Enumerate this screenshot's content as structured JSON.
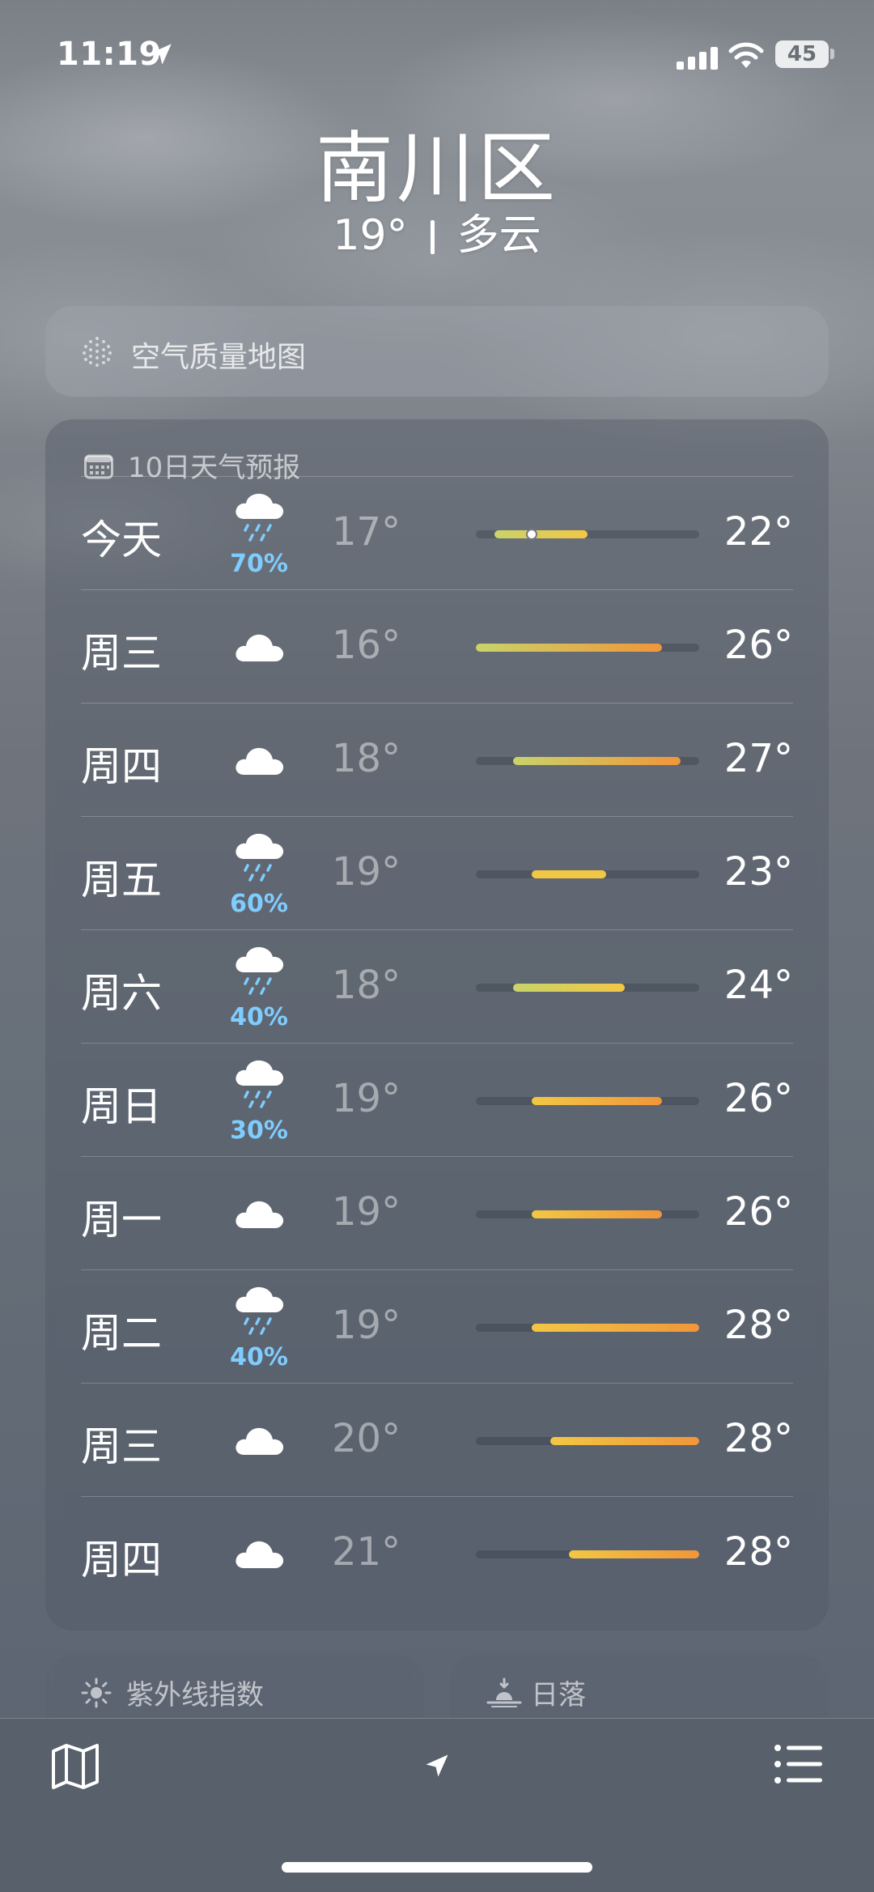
{
  "status_bar": {
    "time": "11:19",
    "battery": "45",
    "icons": [
      "location-arrow-icon",
      "cellular-signal-icon",
      "wifi-icon",
      "battery-icon"
    ]
  },
  "header": {
    "city": "南川区",
    "temperature": "19°",
    "condition": "多云"
  },
  "air_quality": {
    "label": "空气质量地图",
    "icon": "air-quality-dots-icon"
  },
  "forecast": {
    "title": "10日天气预报",
    "icon": "calendar-icon",
    "range_min": 16,
    "range_max": 28,
    "current_temp": 19,
    "days": [
      {
        "day": "今天",
        "icon": "cloud-rain-icon",
        "precip": "70%",
        "low": "17°",
        "high": "22°",
        "low_val": 17,
        "high_val": 22,
        "show_current": true
      },
      {
        "day": "周三",
        "icon": "cloud-icon",
        "precip": "",
        "low": "16°",
        "high": "26°",
        "low_val": 16,
        "high_val": 26
      },
      {
        "day": "周四",
        "icon": "cloud-icon",
        "precip": "",
        "low": "18°",
        "high": "27°",
        "low_val": 18,
        "high_val": 27
      },
      {
        "day": "周五",
        "icon": "cloud-rain-icon",
        "precip": "60%",
        "low": "19°",
        "high": "23°",
        "low_val": 19,
        "high_val": 23
      },
      {
        "day": "周六",
        "icon": "cloud-rain-icon",
        "precip": "40%",
        "low": "18°",
        "high": "24°",
        "low_val": 18,
        "high_val": 24
      },
      {
        "day": "周日",
        "icon": "cloud-rain-icon",
        "precip": "30%",
        "low": "19°",
        "high": "26°",
        "low_val": 19,
        "high_val": 26
      },
      {
        "day": "周一",
        "icon": "cloud-icon",
        "precip": "",
        "low": "19°",
        "high": "26°",
        "low_val": 19,
        "high_val": 26
      },
      {
        "day": "周二",
        "icon": "cloud-rain-icon",
        "precip": "40%",
        "low": "19°",
        "high": "28°",
        "low_val": 19,
        "high_val": 28
      },
      {
        "day": "周三",
        "icon": "cloud-icon",
        "precip": "",
        "low": "20°",
        "high": "28°",
        "low_val": 20,
        "high_val": 28
      },
      {
        "day": "周四",
        "icon": "cloud-icon",
        "precip": "",
        "low": "21°",
        "high": "28°",
        "low_val": 21,
        "high_val": 28
      }
    ]
  },
  "uv_card": {
    "label": "紫外线指数",
    "icon": "sun-icon"
  },
  "sunset_card": {
    "label": "日落",
    "icon": "sunset-icon"
  },
  "tab_bar": {
    "items": [
      {
        "icon": "map-icon"
      },
      {
        "icon": "location-arrow-icon"
      },
      {
        "icon": "list-icon"
      }
    ]
  },
  "colors": {
    "precip": "#7fcdff",
    "bar_cool": "#c9d36a",
    "bar_mid": "#f2c744",
    "bar_warm": "#f0963a"
  }
}
